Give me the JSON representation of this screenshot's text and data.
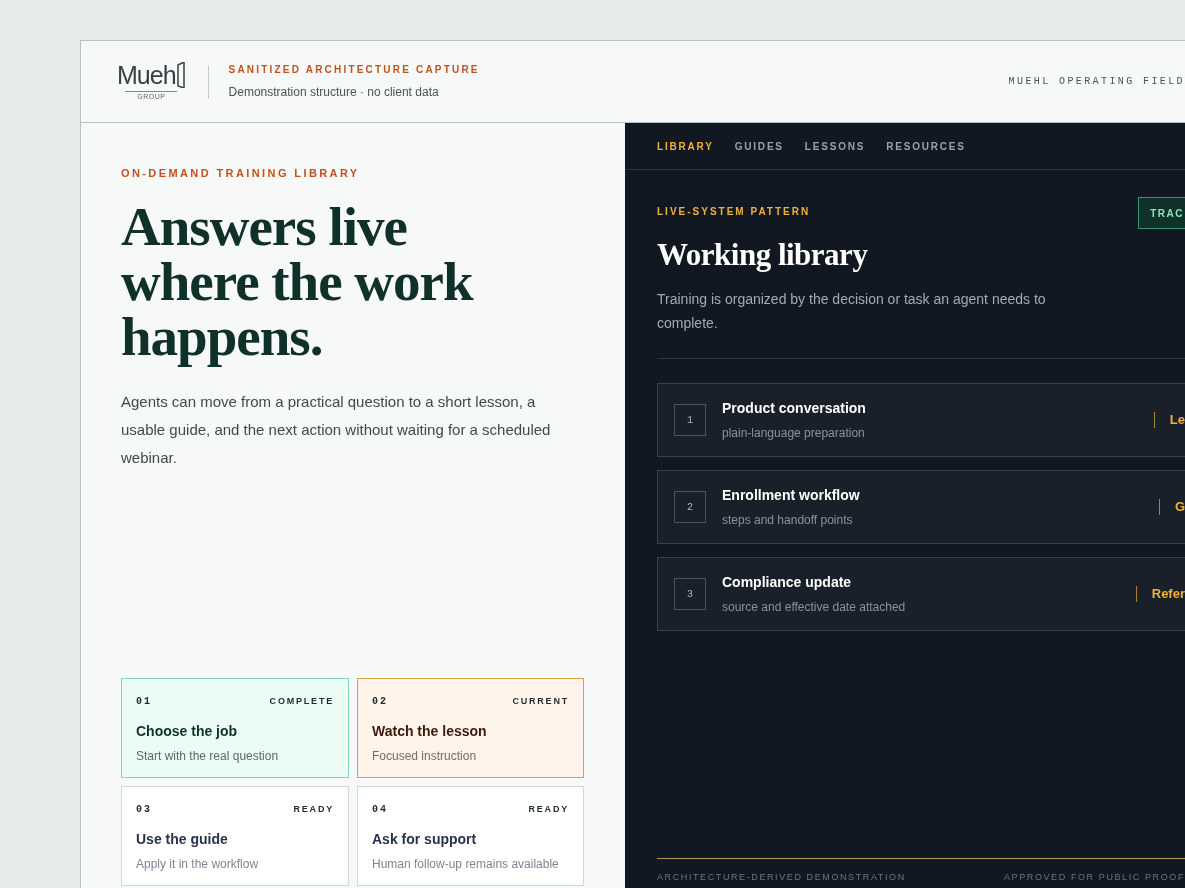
{
  "header": {
    "logo": {
      "text": "Mueh",
      "sub": "GROUP"
    },
    "eyebrow": "SANITIZED ARCHITECTURE CAPTURE",
    "subtitle": "Demonstration structure · no client data",
    "right_label": "MUEHL OPERATING FIELD"
  },
  "hero": {
    "eyebrow": "ON-DEMAND TRAINING LIBRARY",
    "title": "Answers live where the work happens.",
    "body": "Agents can move from a practical question to a short lesson, a usable guide, and the next action without waiting for a scheduled webinar."
  },
  "steps": [
    {
      "number": "01",
      "status": "COMPLETE",
      "kind": "complete",
      "title": "Choose the job",
      "subtitle": "Start with the real question"
    },
    {
      "number": "02",
      "status": "CURRENT",
      "kind": "current",
      "title": "Watch the lesson",
      "subtitle": "Focused instruction"
    },
    {
      "number": "03",
      "status": "READY",
      "kind": "ready",
      "title": "Use the guide",
      "subtitle": "Apply it in the workflow"
    },
    {
      "number": "04",
      "status": "READY",
      "kind": "ready",
      "title": "Ask for support",
      "subtitle": "Human follow-up remains available"
    }
  ],
  "tabs": [
    {
      "label": "LIBRARY",
      "selected": true
    },
    {
      "label": "GUIDES",
      "selected": false
    },
    {
      "label": "LESSONS",
      "selected": false
    },
    {
      "label": "RESOURCES",
      "selected": false
    }
  ],
  "library": {
    "eyebrow": "LIVE-SYSTEM PATTERN",
    "badge": "TRAC",
    "title": "Working library",
    "description": "Training is organized by the decision or task an agent needs to complete.",
    "items": [
      {
        "number": "1",
        "title": "Product conversation",
        "subtitle": "plain-language preparation",
        "tag": "Le"
      },
      {
        "number": "2",
        "title": "Enrollment workflow",
        "subtitle": "steps and handoff points",
        "tag": "G"
      },
      {
        "number": "3",
        "title": "Compliance update",
        "subtitle": "source and effective date attached",
        "tag": "Refer"
      }
    ]
  },
  "footer": {
    "left": "ARCHITECTURE-DERIVED DEMONSTRATION",
    "right": "APPROVED FOR PUBLIC PROOF"
  }
}
